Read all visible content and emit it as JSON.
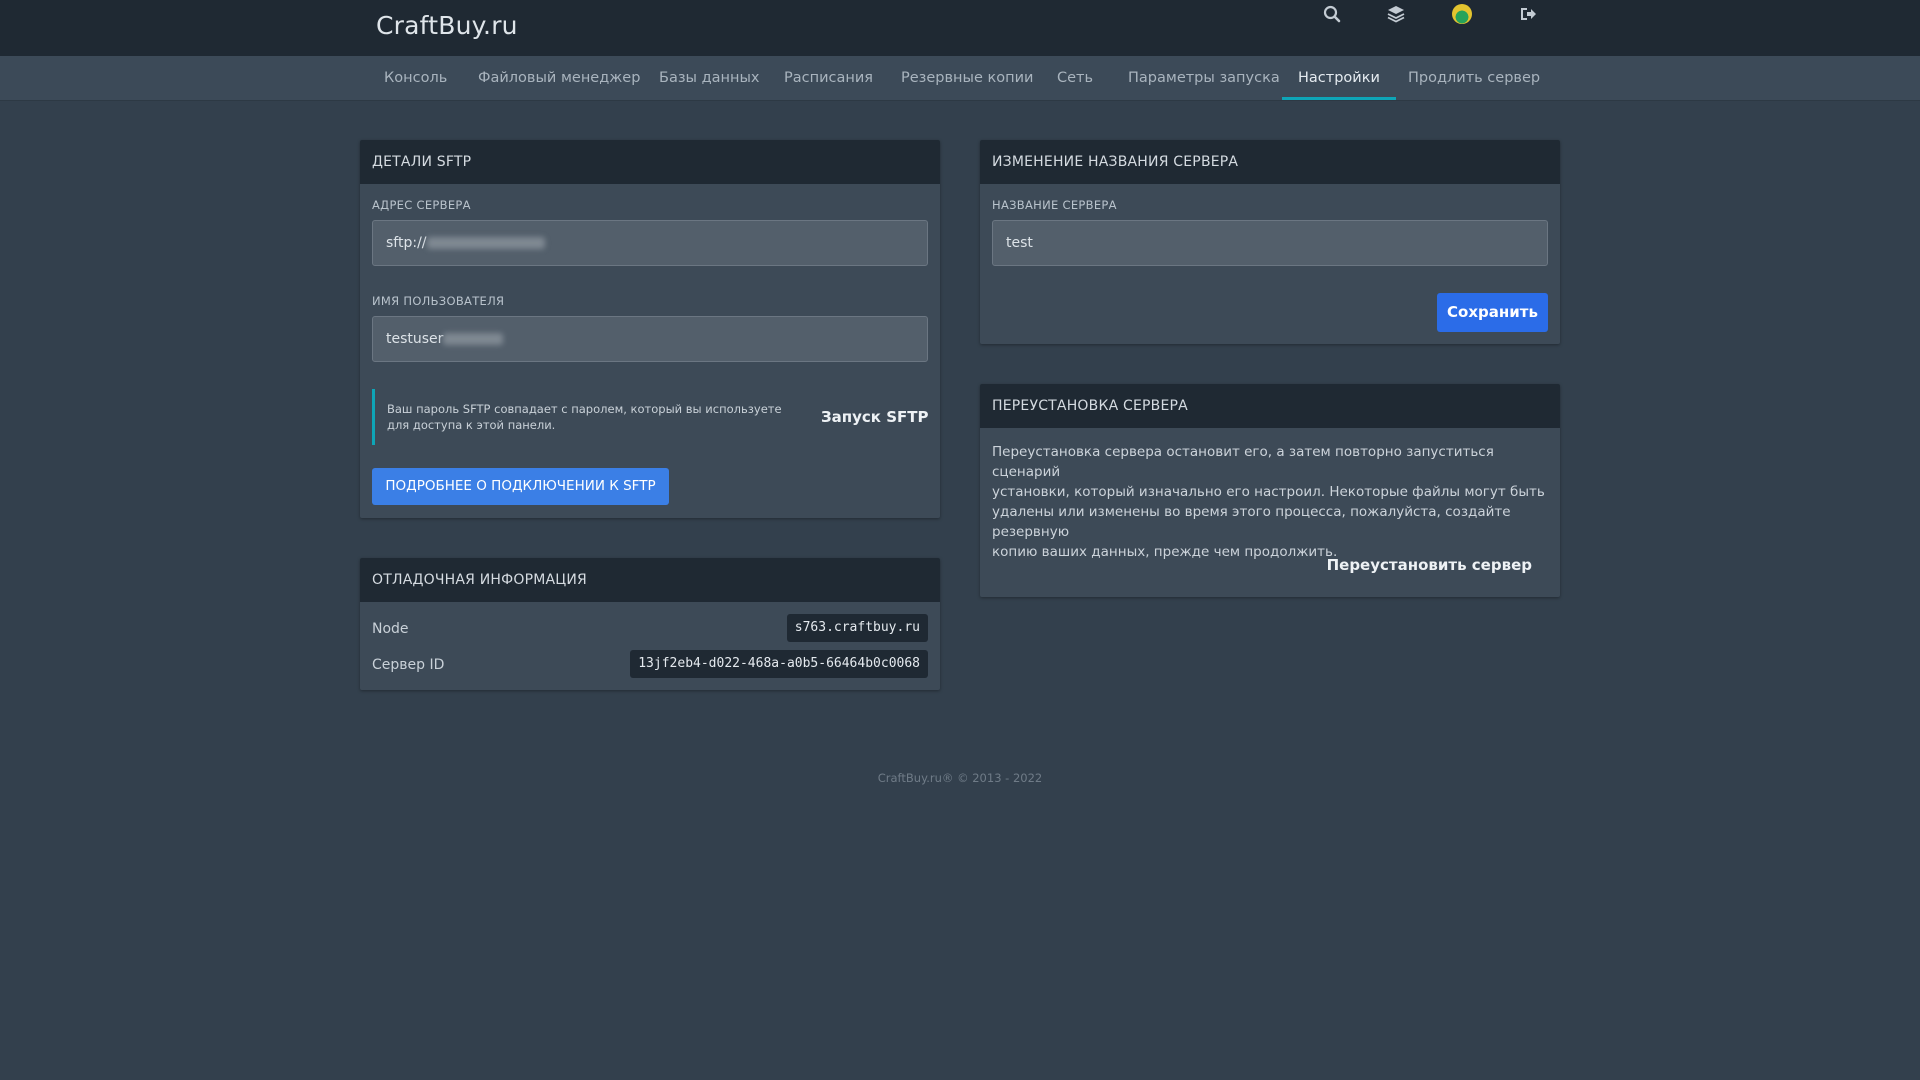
{
  "brand": "CraftBuy.ru",
  "header_icons": [
    "search-icon",
    "layers-icon",
    "avatar",
    "logout-icon"
  ],
  "nav": {
    "tabs": [
      {
        "label": "Консоль"
      },
      {
        "label": "Файловый менеджер"
      },
      {
        "label": "Базы данных"
      },
      {
        "label": "Расписания"
      },
      {
        "label": "Резервные копии"
      },
      {
        "label": "Сеть"
      },
      {
        "label": "Параметры запуска"
      },
      {
        "label": "Настройки",
        "active": true
      },
      {
        "label": "Продлить сервер"
      }
    ]
  },
  "sftp": {
    "title": "ДЕТАЛИ SFTP",
    "address_label": "АДРЕС СЕРВЕРА",
    "address_value": "sftp://",
    "username_label": "ИМЯ ПОЛЬЗОВАТЕЛЯ",
    "username_value": "testuser",
    "note_line1": "Ваш пароль SFTP совпадает с паролем, который вы используете",
    "note_line2": "для доступа к этой панели.",
    "launch_label": "Запуск SFTP",
    "more_button": "ПОДРОБНЕЕ О ПОДКЛЮЧЕНИИ К SFTP"
  },
  "debug": {
    "title": "ОТЛАДОЧНАЯ ИНФОРМАЦИЯ",
    "node_label": "Node",
    "node_value": "s763.craftbuy.ru",
    "server_id_label": "Сервер ID",
    "server_id_value": "13jf2eb4-d022-468a-a0b5-66464b0c0068"
  },
  "rename": {
    "title": "ИЗМЕНЕНИЕ НАЗВАНИЯ СЕРВЕРА",
    "name_label": "НАЗВАНИЕ СЕРВЕРА",
    "name_value": "test",
    "save_button": "Сохранить"
  },
  "reinstall": {
    "title": "ПЕРЕУСТАНОВКА СЕРВЕРА",
    "line1": "Переустановка сервера остановит его, а затем повторно запуститься сценарий",
    "line2": "установки, который изначально его настроил. Некоторые файлы могут быть",
    "line3": "удалены или изменены во время этого процесса, пожалуйста, создайте резервную",
    "line4": "копию ваших данных, прежде чем продолжить.",
    "button": "Переустановить сервер"
  },
  "footer": "CraftBuy.ru® © 2013 - 2022",
  "colors": {
    "background": "#33404d",
    "header": "#1f2933",
    "accent_tab": "#0ea5b7",
    "primary_button": "#2b6ce8"
  }
}
